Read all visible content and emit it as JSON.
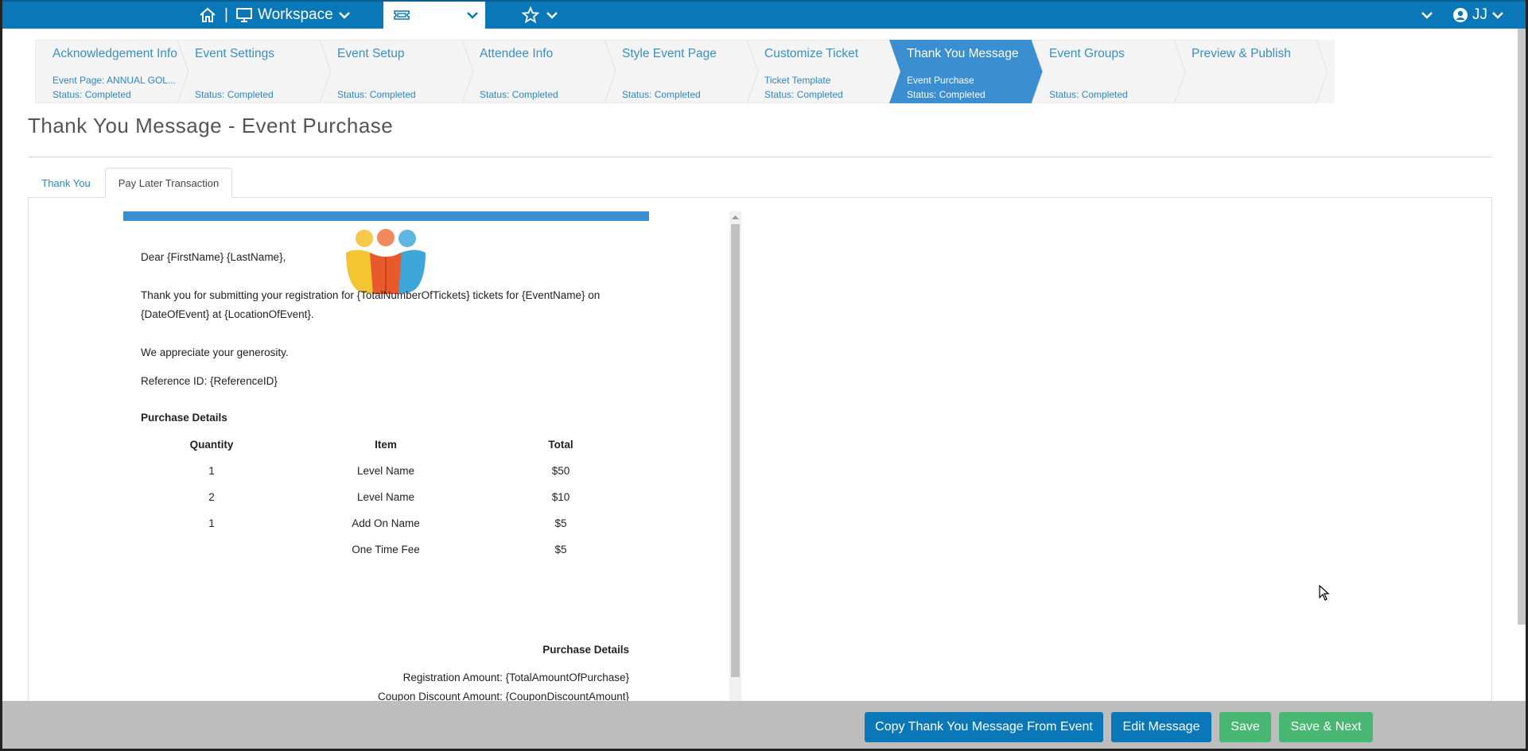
{
  "topbar": {
    "workspace_label": "Workspace",
    "events_label": "Events",
    "user_initials": "JJ",
    "separator": "|"
  },
  "steps": [
    {
      "name": "Acknowledgement Info",
      "sub": "Event Page: ANNUAL GOL...",
      "status": "Status: Completed",
      "active": false
    },
    {
      "name": "Event Settings",
      "sub": "",
      "status": "Status: Completed",
      "active": false
    },
    {
      "name": "Event Setup",
      "sub": "",
      "status": "Status: Completed",
      "active": false
    },
    {
      "name": "Attendee Info",
      "sub": "",
      "status": "Status: Completed",
      "active": false
    },
    {
      "name": "Style Event Page",
      "sub": "",
      "status": "Status: Completed",
      "active": false
    },
    {
      "name": "Customize Ticket",
      "sub": "Ticket Template",
      "status": "Status: Completed",
      "active": false
    },
    {
      "name": "Thank You Message",
      "sub": "Event Purchase",
      "status": "Status: Completed",
      "active": true
    },
    {
      "name": "Event Groups",
      "sub": "",
      "status": "Status: Completed",
      "active": false
    },
    {
      "name": "Preview & Publish",
      "sub": "",
      "status": "",
      "active": false
    }
  ],
  "page_title": "Thank You Message - Event Purchase",
  "tabs": {
    "thank_you": "Thank You",
    "pay_later": "Pay Later Transaction"
  },
  "email": {
    "greeting": "Dear {FirstName} {LastName},",
    "body_line1": "Thank you for submitting your registration for {TotalNumberOfTickets} tickets for {EventName} on",
    "body_line2": "{DateOfEvent} at {LocationOfEvent}.",
    "appreciation": "We appreciate your generosity.",
    "reference": "Reference ID: {ReferenceID}",
    "purchase_heading": "Purchase Details",
    "table_headers": {
      "quantity": "Quantity",
      "item": "Item",
      "total": "Total"
    },
    "table_rows": [
      {
        "quantity": "1",
        "item": "Level Name",
        "total": "$50"
      },
      {
        "quantity": "2",
        "item": "Level Name",
        "total": "$10"
      },
      {
        "quantity": "1",
        "item": "Add On Name",
        "total": "$5"
      },
      {
        "quantity": "",
        "item": "One Time Fee",
        "total": "$5"
      }
    ],
    "summary_heading": "Purchase Details",
    "registration_amount": "Registration Amount: {TotalAmountOfPurchase}",
    "coupon_amount": "Coupon Discount Amount: {CouponDiscountAmount}"
  },
  "footer": {
    "copy_button": "Copy Thank You Message From Event",
    "edit_button": "Edit Message",
    "save_button": "Save",
    "save_next_button": "Save & Next"
  },
  "colors": {
    "brand_blue": "#0a77b8",
    "active_step": "#3b8fd0",
    "save_green": "#47b772"
  }
}
